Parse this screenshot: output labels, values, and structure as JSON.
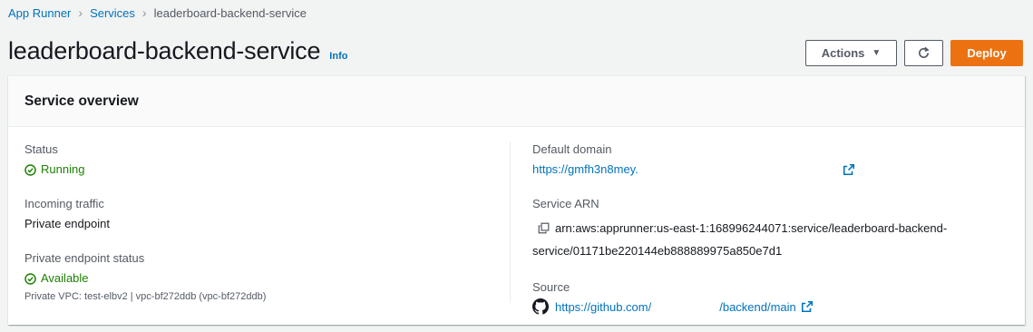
{
  "breadcrumb": {
    "root": "App Runner",
    "services": "Services",
    "current": "leaderboard-backend-service"
  },
  "header": {
    "title": "leaderboard-backend-service",
    "info": "Info",
    "actions_label": "Actions",
    "deploy_label": "Deploy"
  },
  "overview": {
    "title": "Service overview",
    "status": {
      "label": "Status",
      "value": "Running"
    },
    "incoming_traffic": {
      "label": "Incoming traffic",
      "value": "Private endpoint"
    },
    "private_endpoint_status": {
      "label": "Private endpoint status",
      "value": "Available",
      "detail": "Private VPC: test-elbv2 | vpc-bf272ddb (vpc-bf272ddb)"
    },
    "default_domain": {
      "label": "Default domain",
      "value": "https://gmfh3n8mey."
    },
    "service_arn": {
      "label": "Service ARN",
      "line1": "arn:aws:apprunner:us-east-1:168996244071:service/leaderboard-backend-",
      "line2": "service/01171be220144eb888889975a850e7d1"
    },
    "source": {
      "label": "Source",
      "prefix": "https://github.com/",
      "suffix": "/backend/main"
    }
  },
  "colors": {
    "link": "#0073bb",
    "success": "#1d8102",
    "primary": "#ec7211"
  }
}
